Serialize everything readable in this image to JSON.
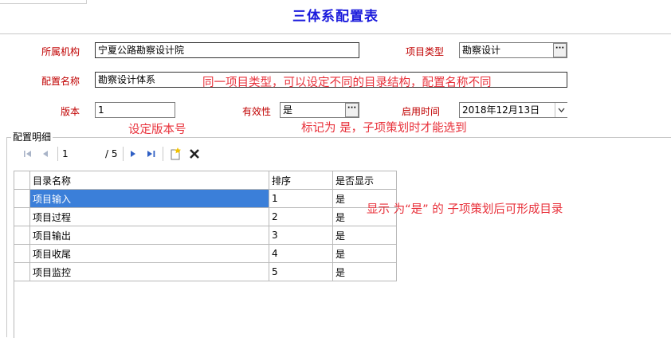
{
  "title": "三体系配置表",
  "form": {
    "org_label": "所属机构",
    "org_value": "宁夏公路勘察设计院",
    "type_label": "项目类型",
    "type_value": "勘察设计",
    "config_label": "配置名称",
    "config_value": "勘察设计体系",
    "version_label": "版本",
    "version_value": "1",
    "valid_label": "有效性",
    "valid_value": "是",
    "date_label": "启用时间",
    "date_value": "2018年12月13日"
  },
  "annotations": {
    "config_note": "同一项目类型，可以设定不同的目录结构，配置名称不同",
    "version_note": "设定版本号",
    "valid_note": "标记为 是，子项策划时才能选到",
    "display_note": "显示 为“是” 的 子项策划后可形成目录"
  },
  "detail": {
    "group_title": "配置明细",
    "pager": {
      "current": "1",
      "total": "/ 5"
    },
    "columns": [
      "目录名称",
      "排序",
      "是否显示"
    ],
    "rows": [
      {
        "name": "项目输入",
        "order": "1",
        "show": "是"
      },
      {
        "name": "项目过程",
        "order": "2",
        "show": "是"
      },
      {
        "name": "项目输出",
        "order": "3",
        "show": "是"
      },
      {
        "name": "项目收尾",
        "order": "4",
        "show": "是"
      },
      {
        "name": "项目监控",
        "order": "5",
        "show": "是"
      }
    ]
  },
  "icons": {
    "first": "first-page-icon",
    "prev": "prev-page-icon",
    "next": "next-page-icon",
    "last": "last-page-icon",
    "add": "add-row-icon",
    "delete": "delete-icon",
    "dots": "ellipsis-icon",
    "dropdown": "chevron-down-icon"
  },
  "colors": {
    "title": "#1a1adc",
    "label": "#c00000",
    "annotation": "#e8303a",
    "selected_row": "#3b7fd9"
  }
}
